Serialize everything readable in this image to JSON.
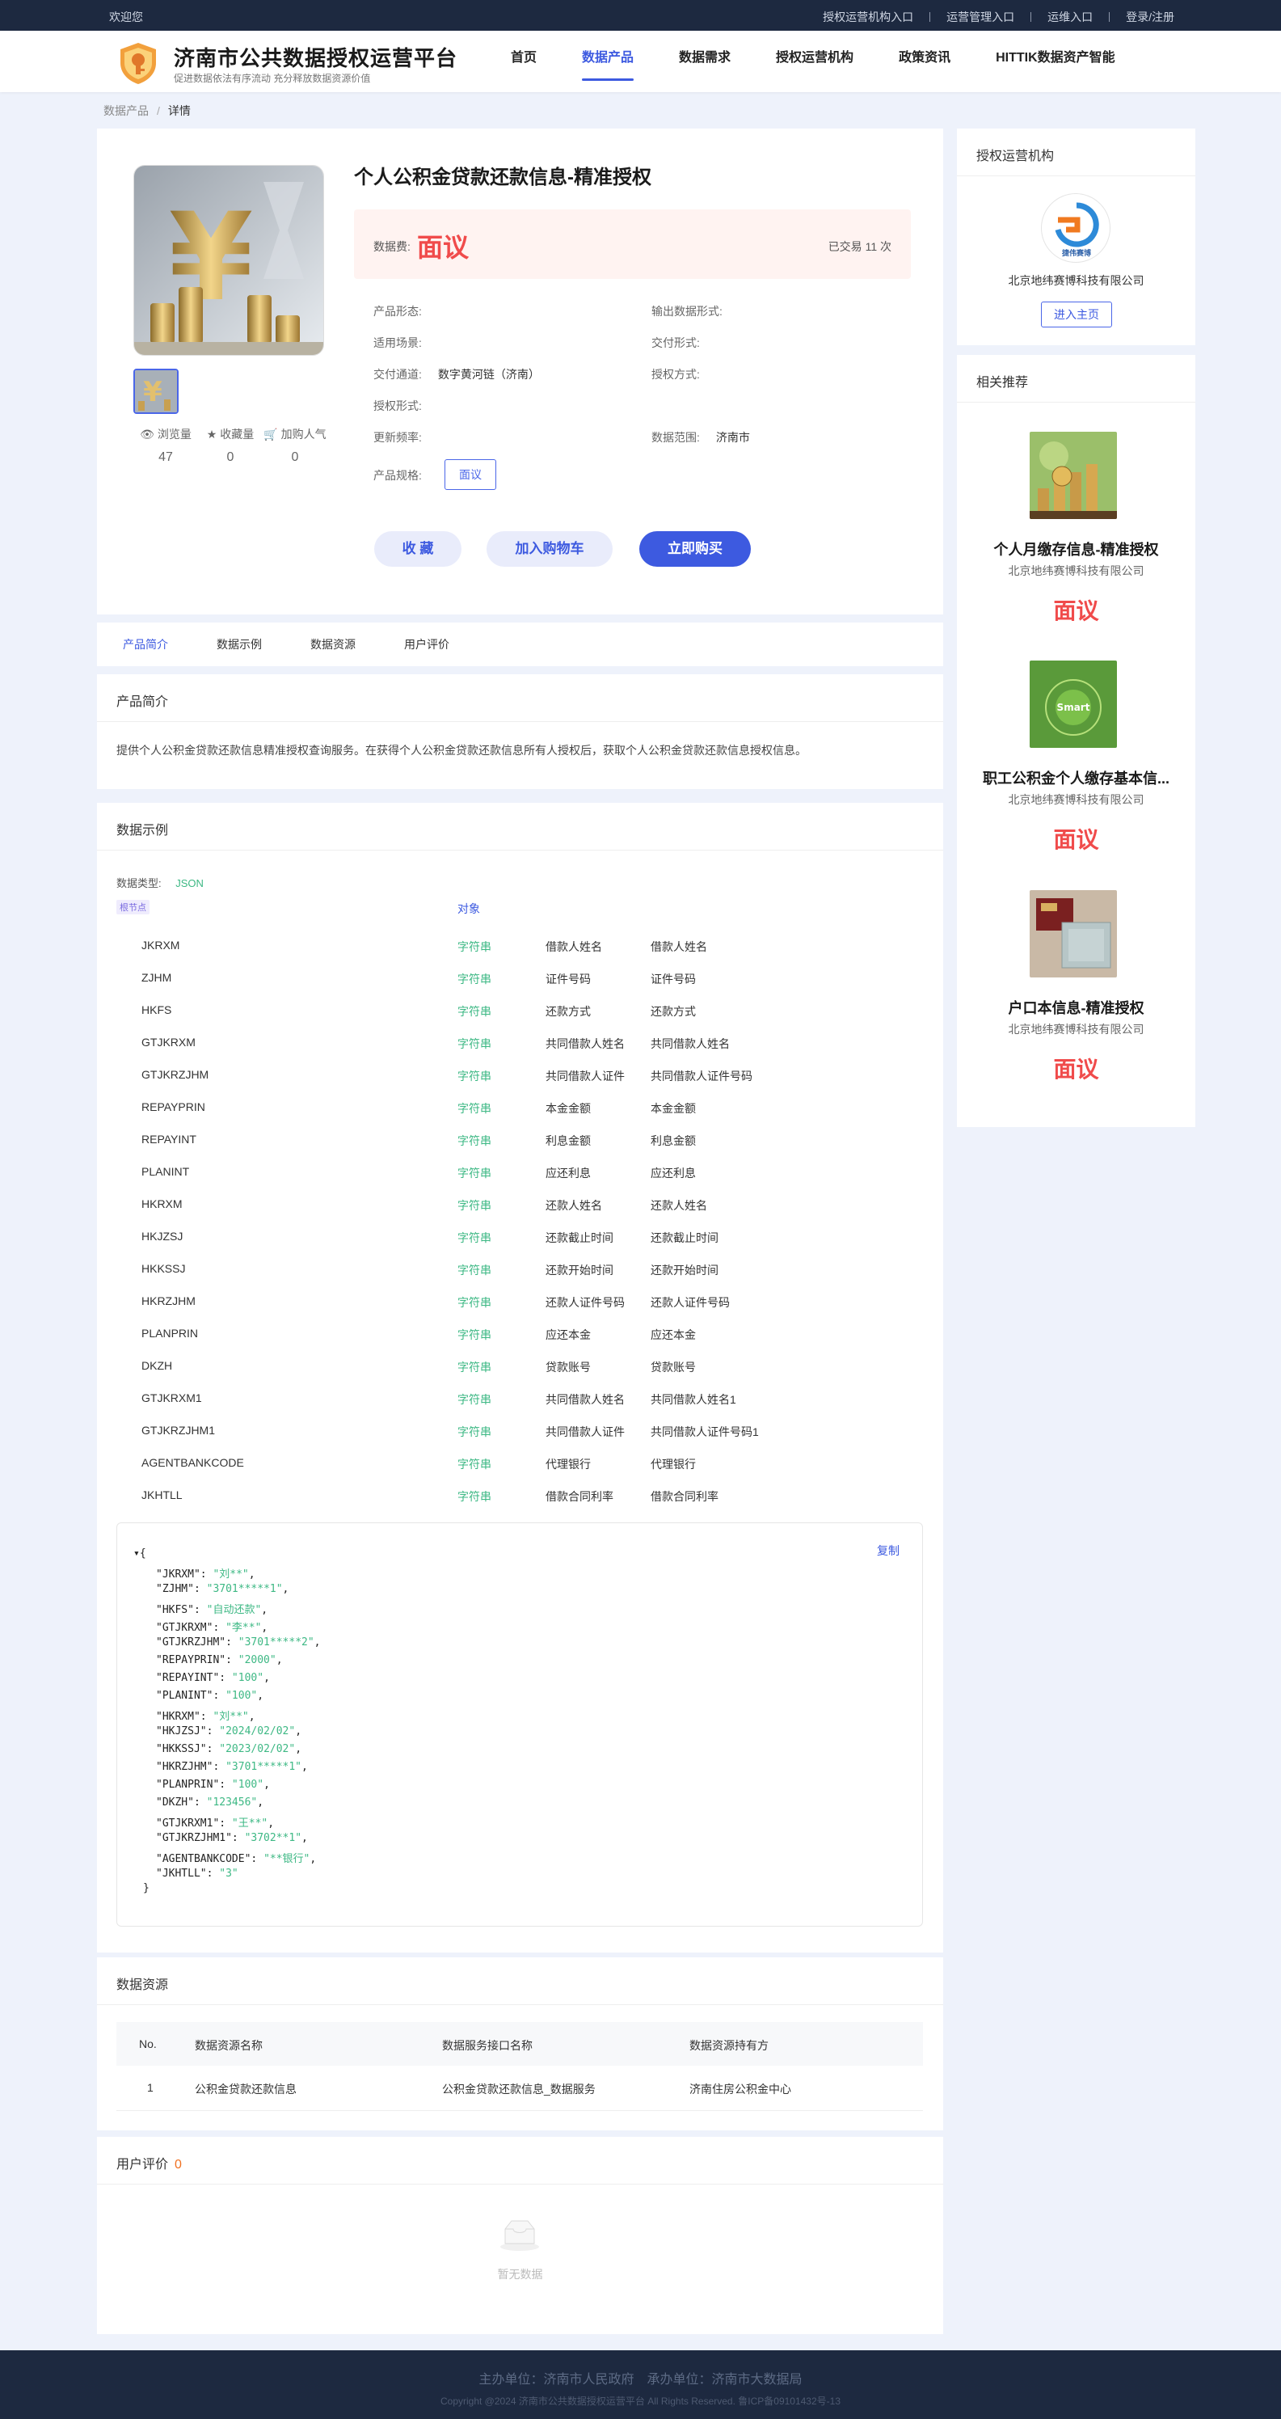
{
  "topbar": {
    "welcome": "欢迎您",
    "links": [
      "授权运营机构入口",
      "运营管理入口",
      "运维入口",
      "登录/注册"
    ]
  },
  "header": {
    "title": "济南市公共数据授权运营平台",
    "subtitle": "促进数据依法有序流动 充分释放数据资源价值",
    "nav": [
      "首页",
      "数据产品",
      "数据需求",
      "授权运营机构",
      "政策资讯",
      "HITTIK数据资产智能"
    ],
    "active_nav": "数据产品"
  },
  "breadcrumb": {
    "parent": "数据产品",
    "separator": "/",
    "current": "详情"
  },
  "product": {
    "title": "个人公积金贷款还款信息-精准授权",
    "price_label": "数据费:",
    "price": "面议",
    "deal_label": "已交易 11 次",
    "stats": [
      {
        "label": "浏览量",
        "value": "47",
        "icon": "eye-icon"
      },
      {
        "label": "收藏量",
        "value": "0",
        "icon": "star-icon"
      },
      {
        "label": "加购人气",
        "value": "0",
        "icon": "cart-icon"
      }
    ],
    "attrs": {
      "form_label": "产品形态:",
      "form_value": "",
      "output_label": "输出数据形式:",
      "output_value": "",
      "scene_label": "适用场景:",
      "scene_value": "",
      "delivery_label": "交付形式:",
      "delivery_value": "",
      "channel_label": "交付通道:",
      "channel_value": "数字黄河链（济南）",
      "auth_label": "授权方式:",
      "auth_value": "",
      "authform_label": "授权形式:",
      "authform_value": "",
      "freq_label": "更新频率:",
      "freq_value": "",
      "range_label": "数据范围:",
      "range_value": "济南市",
      "spec_label": "产品规格:",
      "spec_value": "面议"
    },
    "buttons": {
      "favorite": "收 藏",
      "cart": "加入购物车",
      "buy": "立即购买"
    }
  },
  "tabs": [
    "产品简介",
    "数据示例",
    "数据资源",
    "用户评价"
  ],
  "intro": {
    "heading": "产品简介",
    "text": "提供个人公积金贷款还款信息精准授权查询服务。在获得个人公积金贷款还款信息所有人授权后，获取个人公积金贷款还款信息授权信息。"
  },
  "sample": {
    "heading": "数据示例",
    "type_label": "数据类型:",
    "type_value": "JSON",
    "root_badge": "根节点",
    "root_type": "对象",
    "fields": [
      {
        "name": "JKRXM",
        "type": "字符串",
        "desc": "借款人姓名",
        "remark": "借款人姓名"
      },
      {
        "name": "ZJHM",
        "type": "字符串",
        "desc": "证件号码",
        "remark": "证件号码"
      },
      {
        "name": "HKFS",
        "type": "字符串",
        "desc": "还款方式",
        "remark": "还款方式"
      },
      {
        "name": "GTJKRXM",
        "type": "字符串",
        "desc": "共同借款人姓名",
        "remark": "共同借款人姓名"
      },
      {
        "name": "GTJKRZJHM",
        "type": "字符串",
        "desc": "共同借款人证件",
        "remark": "共同借款人证件号码"
      },
      {
        "name": "REPAYPRIN",
        "type": "字符串",
        "desc": "本金金额",
        "remark": "本金金额"
      },
      {
        "name": "REPAYINT",
        "type": "字符串",
        "desc": "利息金额",
        "remark": "利息金额"
      },
      {
        "name": "PLANINT",
        "type": "字符串",
        "desc": "应还利息",
        "remark": "应还利息"
      },
      {
        "name": "HKRXM",
        "type": "字符串",
        "desc": "还款人姓名",
        "remark": "还款人姓名"
      },
      {
        "name": "HKJZSJ",
        "type": "字符串",
        "desc": "还款截止时间",
        "remark": "还款截止时间"
      },
      {
        "name": "HKKSSJ",
        "type": "字符串",
        "desc": "还款开始时间",
        "remark": "还款开始时间"
      },
      {
        "name": "HKRZJHM",
        "type": "字符串",
        "desc": "还款人证件号码",
        "remark": "还款人证件号码"
      },
      {
        "name": "PLANPRIN",
        "type": "字符串",
        "desc": "应还本金",
        "remark": "应还本金"
      },
      {
        "name": "DKZH",
        "type": "字符串",
        "desc": "贷款账号",
        "remark": "贷款账号"
      },
      {
        "name": "GTJKRXM1",
        "type": "字符串",
        "desc": "共同借款人姓名",
        "remark": "共同借款人姓名1"
      },
      {
        "name": "GTJKRZJHM1",
        "type": "字符串",
        "desc": "共同借款人证件",
        "remark": "共同借款人证件号码1"
      },
      {
        "name": "AGENTBANKCODE",
        "type": "字符串",
        "desc": "代理银行",
        "remark": "代理银行"
      },
      {
        "name": "JKHTLL",
        "type": "字符串",
        "desc": "借款合同利率",
        "remark": "借款合同利率"
      }
    ],
    "copy_label": "复制",
    "json_open": "{",
    "json_close": "}",
    "json_pairs": [
      {
        "k": "\"JKRXM\": ",
        "v": "\"刘**\"",
        "c": ","
      },
      {
        "k": "\"ZJHM\": ",
        "v": "\"3701*****1\"",
        "c": ","
      },
      {
        "k": "\"HKFS\": ",
        "v": "\"自动还款\"",
        "c": ","
      },
      {
        "k": "\"GTJKRXM\": ",
        "v": "\"李**\"",
        "c": ","
      },
      {
        "k": "\"GTJKRZJHM\": ",
        "v": "\"3701*****2\"",
        "c": ","
      },
      {
        "k": "\"REPAYPRIN\": ",
        "v": "\"2000\"",
        "c": ","
      },
      {
        "k": "\"REPAYINT\": ",
        "v": "\"100\"",
        "c": ","
      },
      {
        "k": "\"PLANINT\": ",
        "v": "\"100\"",
        "c": ","
      },
      {
        "k": "\"HKRXM\": ",
        "v": "\"刘**\"",
        "c": ","
      },
      {
        "k": "\"HKJZSJ\": ",
        "v": "\"2024/02/02\"",
        "c": ","
      },
      {
        "k": "\"HKKSSJ\": ",
        "v": "\"2023/02/02\"",
        "c": ","
      },
      {
        "k": "\"HKRZJHM\": ",
        "v": "\"3701*****1\"",
        "c": ","
      },
      {
        "k": "\"PLANPRIN\": ",
        "v": "\"100\"",
        "c": ","
      },
      {
        "k": "\"DKZH\": ",
        "v": "\"123456\"",
        "c": ","
      },
      {
        "k": "\"GTJKRXM1\": ",
        "v": "\"王**\"",
        "c": ","
      },
      {
        "k": "\"GTJKRZJHM1\": ",
        "v": "\"3702**1\"",
        "c": ","
      },
      {
        "k": "\"AGENTBANKCODE\": ",
        "v": "\"**银行\"",
        "c": ","
      },
      {
        "k": "\"JKHTLL\": ",
        "v": "\"3\"",
        "c": ""
      }
    ]
  },
  "resources": {
    "heading": "数据资源",
    "columns": [
      "No.",
      "数据资源名称",
      "数据服务接口名称",
      "数据资源持有方"
    ],
    "rows": [
      [
        "1",
        "公积金贷款还款信息",
        "公积金贷款还款信息_数据服务",
        "济南住房公积金中心"
      ]
    ]
  },
  "review": {
    "heading": "用户评价",
    "count": "0",
    "empty": "暂无数据"
  },
  "side_org": {
    "heading": "授权运营机构",
    "logo_text": "捷伟赛博",
    "name": "北京地纬赛博科技有限公司",
    "enter": "进入主页"
  },
  "side_rec": {
    "heading": "相关推荐",
    "items": [
      {
        "title": "个人月缴存信息-精准授权",
        "org": "北京地纬赛博科技有限公司",
        "price": "面议"
      },
      {
        "title": "职工公积金个人缴存基本信...",
        "org": "北京地纬赛博科技有限公司",
        "price": "面议",
        "img_text": "Smart"
      },
      {
        "title": "户口本信息-精准授权",
        "org": "北京地纬赛博科技有限公司",
        "price": "面议"
      }
    ]
  },
  "footer": {
    "line1": "主办单位：济南市人民政府　承办单位：济南市大数据局",
    "line2": "Copyright @2024 济南市公共数据授权运营平台 All Rights Reserved. 鲁ICP备09101432号-13"
  },
  "colors": {
    "primary": "#3d5ae0",
    "price": "#f04b4b",
    "string_type": "#3db884",
    "topbar": "#1d2940"
  }
}
